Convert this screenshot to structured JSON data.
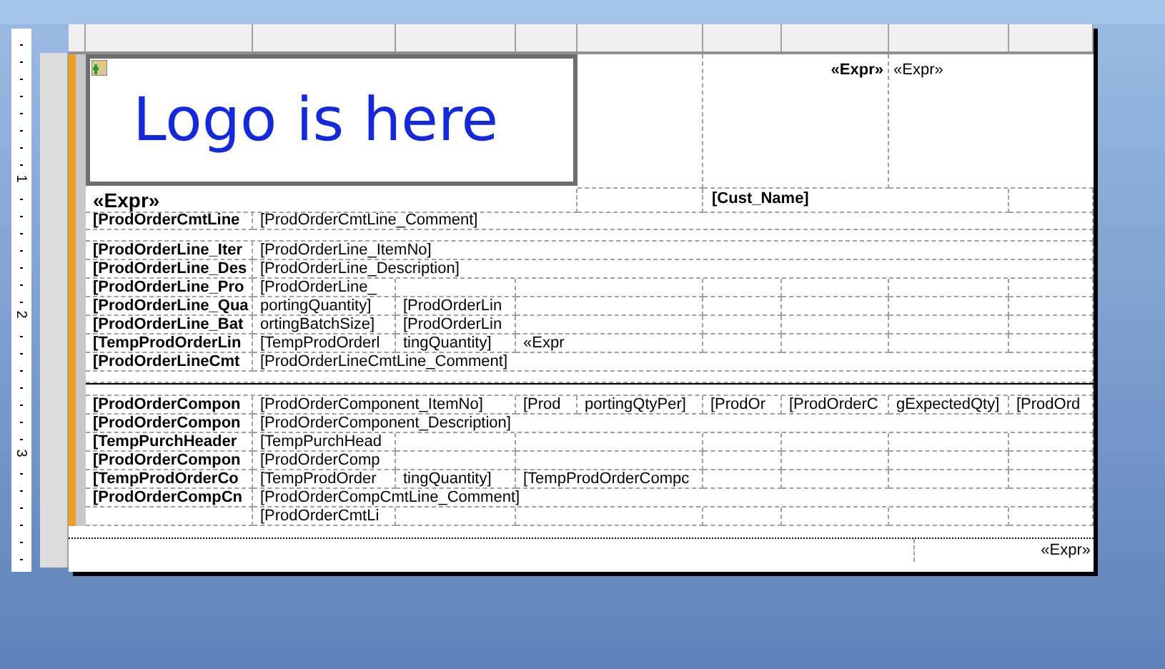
{
  "ruler": {
    "labels": [
      "1",
      "2",
      "3"
    ]
  },
  "logo_band": {
    "note": "Logo is here",
    "expr_bold": "«Expr»",
    "expr": "«Expr»"
  },
  "title_row": {
    "expr": "«Expr»",
    "customer": "[Cust_Name]"
  },
  "rows": [
    {
      "kind": "wide",
      "cells": [
        "[ProdOrderCmtLine",
        "[ProdOrderCmtLine_Comment]"
      ]
    },
    {
      "kind": "spacer"
    },
    {
      "kind": "wide",
      "cells": [
        "[ProdOrderLine_Iter",
        "[ProdOrderLine_ItemNo]"
      ]
    },
    {
      "kind": "wide",
      "cells": [
        "[ProdOrderLine_Des",
        "[ProdOrderLine_Description]"
      ]
    },
    {
      "kind": "line",
      "cells": [
        "[ProdOrderLine_Pro",
        "[ProdOrderLine_"
      ]
    },
    {
      "kind": "line",
      "cells": [
        "[ProdOrderLine_Qua",
        "portingQuantity]",
        "[ProdOrderLin"
      ]
    },
    {
      "kind": "line",
      "cells": [
        "[ProdOrderLine_Bat",
        "ortingBatchSize]",
        "[ProdOrderLin"
      ]
    },
    {
      "kind": "line",
      "cells": [
        "[TempProdOrderLin",
        "[TempProdOrderl",
        "tingQuantity]",
        "«Expr"
      ]
    },
    {
      "kind": "wide",
      "cells": [
        "[ProdOrderLineCmt",
        "[ProdOrderLineCmtLine_Comment]"
      ]
    },
    {
      "kind": "spacer"
    },
    {
      "kind": "separator"
    },
    {
      "kind": "component",
      "cells": [
        "[ProdOrderCompon",
        "[ProdOrderComponent_ItemNo]",
        "[Prod",
        "portingQtyPer]",
        "[ProdOr",
        "[ProdOrderC",
        "gExpectedQty]",
        "[ProdOrd"
      ]
    },
    {
      "kind": "wide",
      "cells": [
        "[ProdOrderCompon",
        "[ProdOrderComponent_Description]"
      ]
    },
    {
      "kind": "line",
      "cells": [
        "[TempPurchHeader",
        "[TempPurchHead"
      ]
    },
    {
      "kind": "line",
      "cells": [
        "[ProdOrderCompon",
        "[ProdOrderComp"
      ]
    },
    {
      "kind": "line",
      "cells": [
        "[TempProdOrderCo",
        "[TempProdOrder",
        "tingQuantity]",
        "[TempProdOrderCompc"
      ]
    },
    {
      "kind": "wide",
      "cells": [
        "[ProdOrderCompCn",
        "[ProdOrderCompCmtLine_Comment]"
      ]
    },
    {
      "kind": "continuation",
      "cells": [
        "[ProdOrderCmtLi"
      ]
    }
  ],
  "footer": {
    "expr": "«Expr»"
  }
}
